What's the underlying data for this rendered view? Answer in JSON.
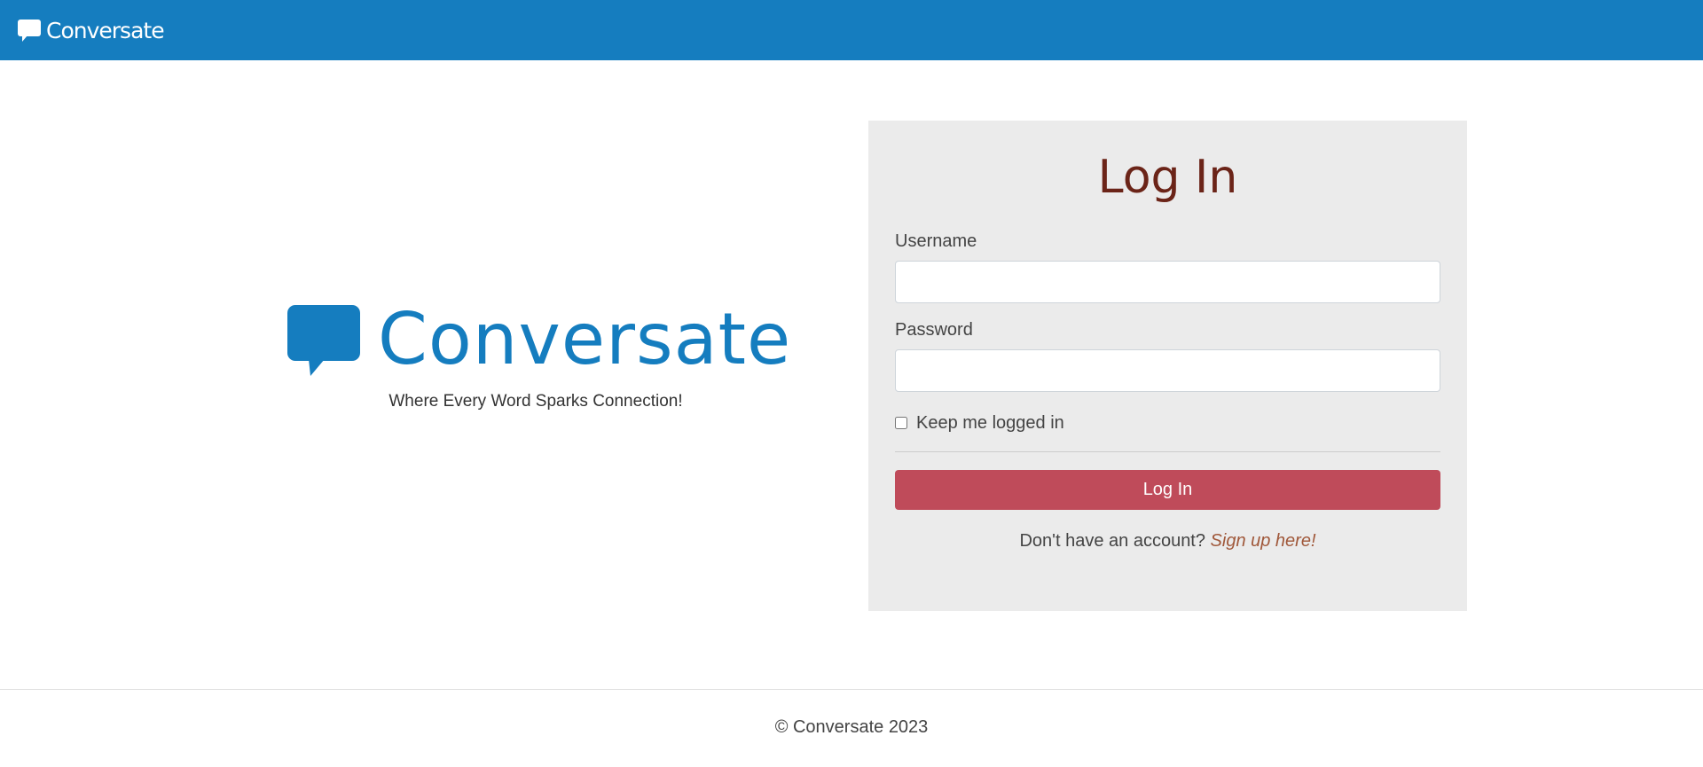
{
  "navbar": {
    "brand": "Conversate",
    "brand_icon": "chat-bubble-icon"
  },
  "hero": {
    "icon": "chat-bubble-icon",
    "title": "Conversate",
    "tagline": "Where Every Word Sparks Connection!"
  },
  "login": {
    "title": "Log In",
    "username_label": "Username",
    "username_value": "",
    "password_label": "Password",
    "password_value": "",
    "remember_label": "Keep me logged in",
    "remember_checked": false,
    "submit_label": "Log In",
    "signup_prompt": "Don't have an account?",
    "signup_link": "Sign up here!"
  },
  "footer": {
    "text": "© Conversate 2023"
  },
  "colors": {
    "brand_blue": "#157dbf",
    "title_brown": "#6b2418",
    "button_red": "#bf4b5a",
    "link_brown": "#a0583a",
    "card_gray": "#ebebeb"
  }
}
